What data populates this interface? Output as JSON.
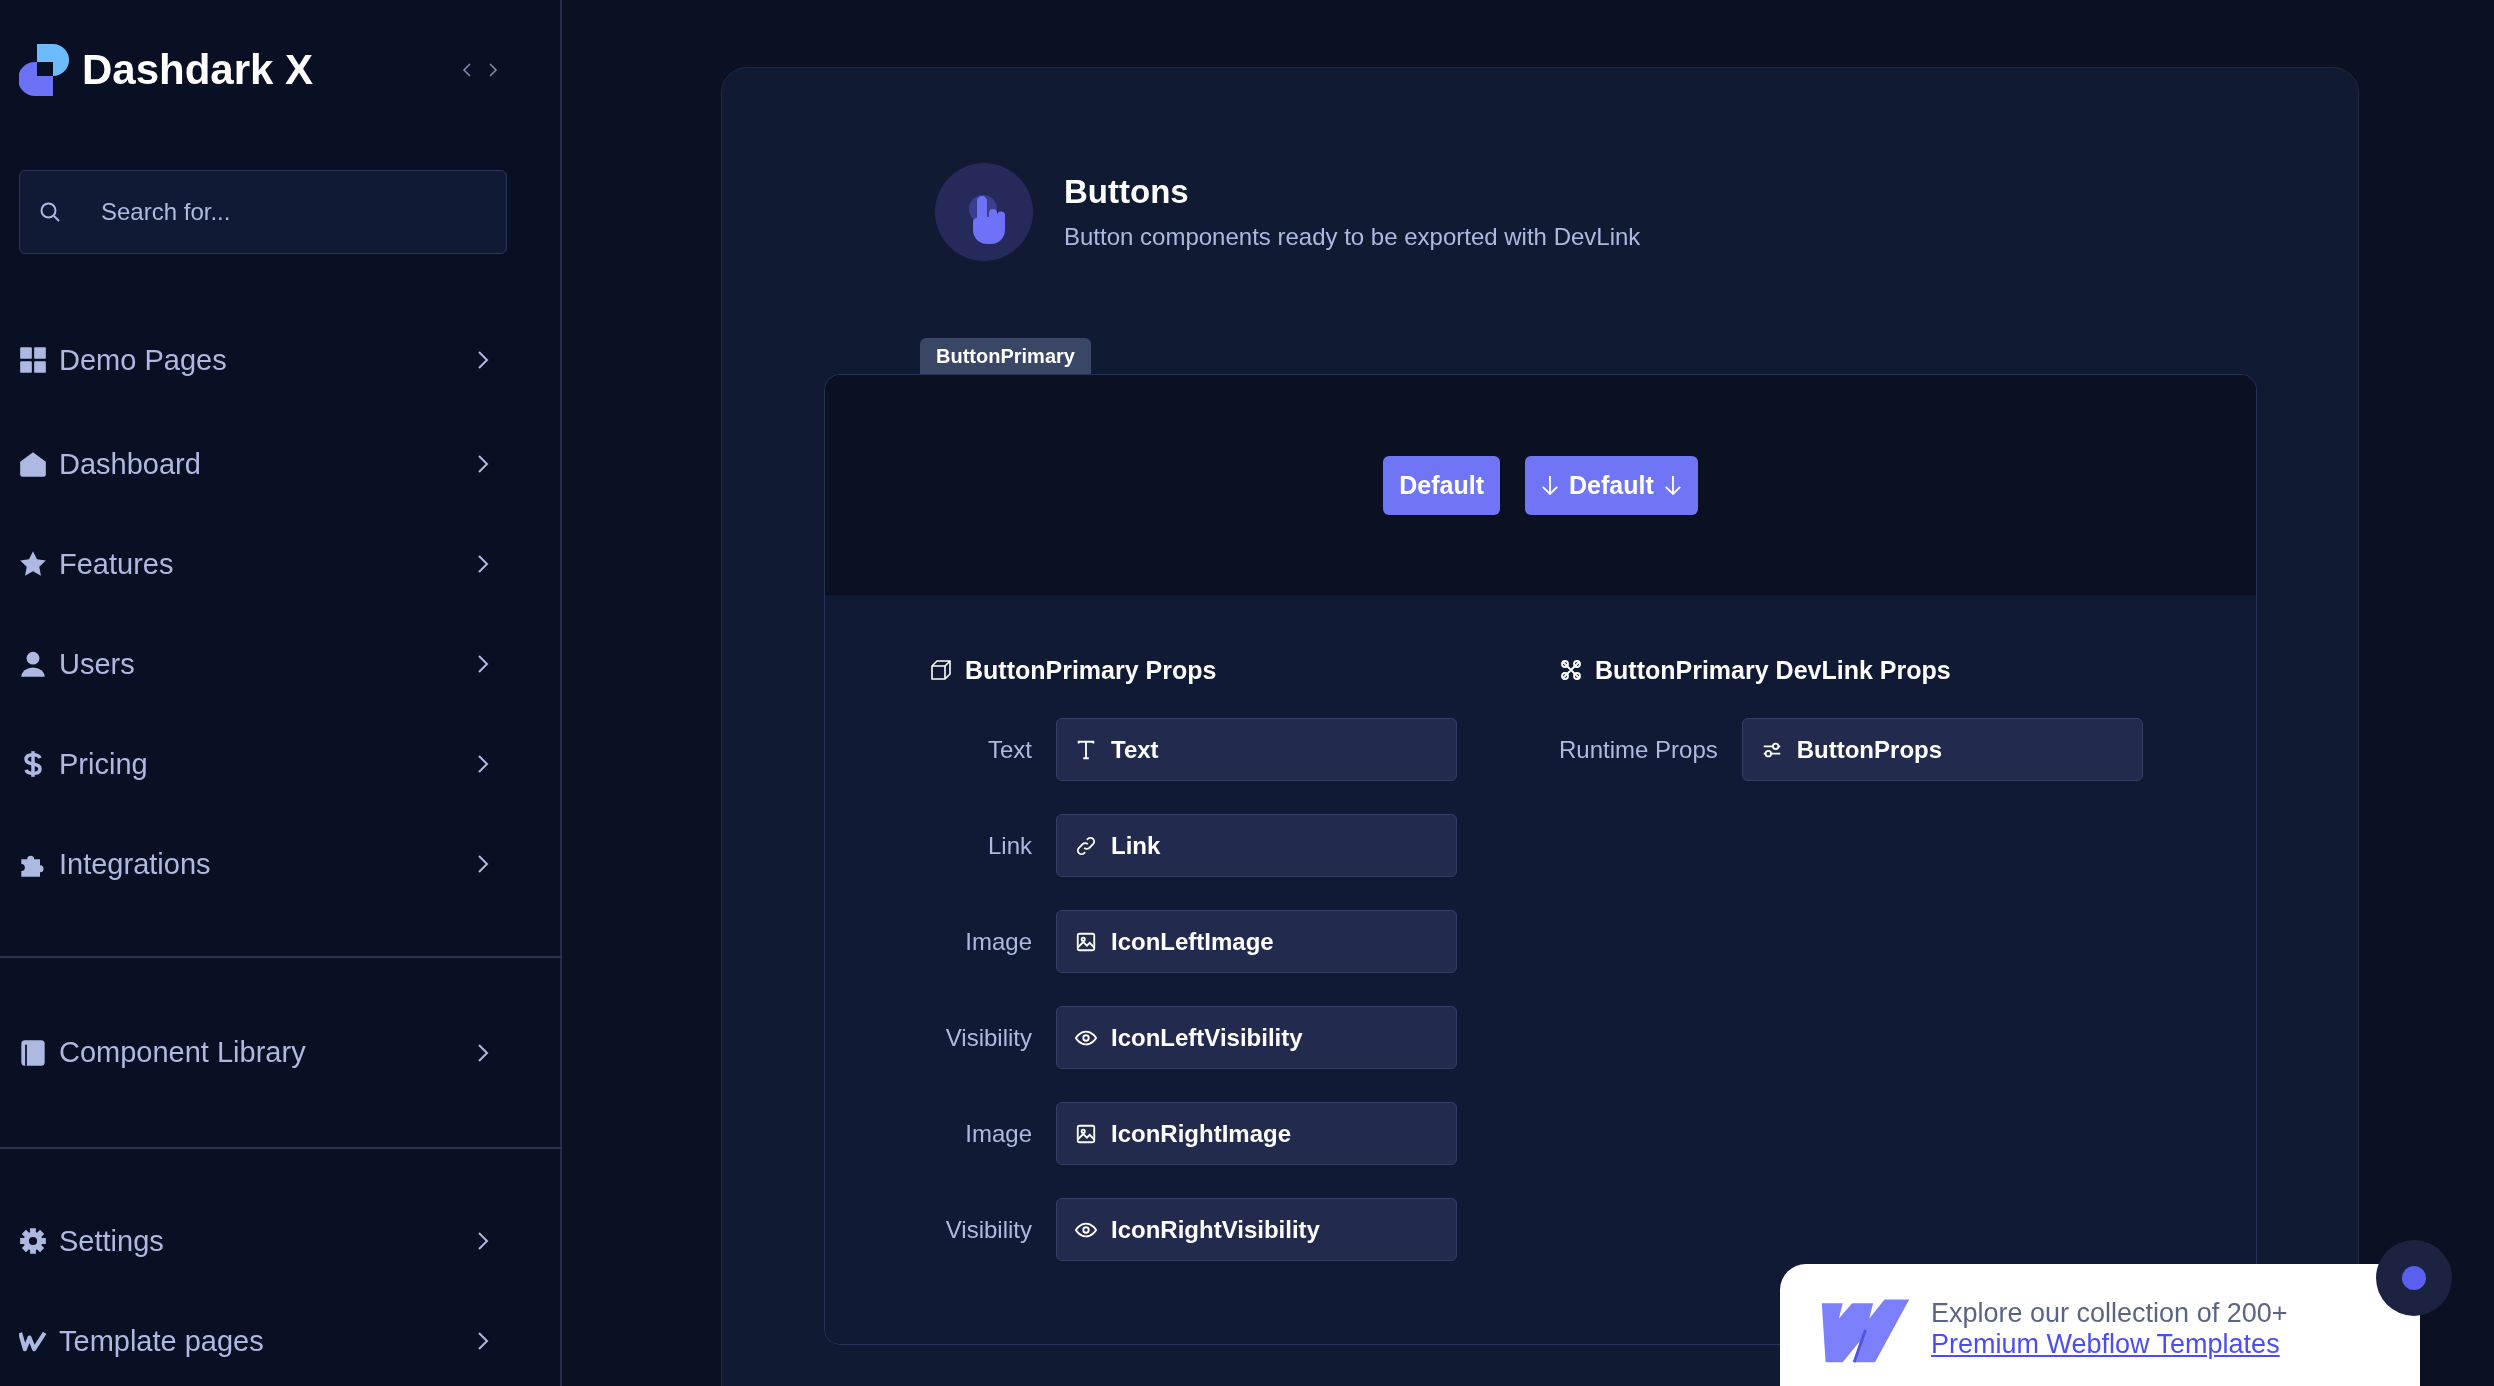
{
  "brand": {
    "name": "Dashdark X"
  },
  "search": {
    "placeholder": "Search for..."
  },
  "nav_groups": [
    {
      "items": [
        {
          "label": "Demo Pages"
        },
        {
          "label": "Dashboard"
        },
        {
          "label": "Features"
        },
        {
          "label": "Users"
        },
        {
          "label": "Pricing"
        },
        {
          "label": "Integrations"
        }
      ]
    },
    {
      "items": [
        {
          "label": "Component Library"
        }
      ]
    },
    {
      "items": [
        {
          "label": "Settings"
        },
        {
          "label": "Template pages"
        }
      ]
    }
  ],
  "header": {
    "title": "Buttons",
    "subtitle": "Button components ready to be exported with DevLink"
  },
  "component": {
    "tab": "ButtonPrimary",
    "preview_buttons": [
      {
        "label": "Default",
        "kind": "plain"
      },
      {
        "label": "Default",
        "kind": "arrows"
      }
    ],
    "props": {
      "title": "ButtonPrimary Props",
      "rows": [
        {
          "label": "Text",
          "value": "Text"
        },
        {
          "label": "Link",
          "value": "Link"
        },
        {
          "label": "Image",
          "value": "IconLeftImage"
        },
        {
          "label": "Visibility",
          "value": "IconLeftVisibility"
        },
        {
          "label": "Image",
          "value": "IconRightImage"
        },
        {
          "label": "Visibility",
          "value": "IconRightVisibility"
        }
      ]
    },
    "devlink_props": {
      "title": "ButtonPrimary DevLink Props",
      "rows": [
        {
          "label": "Runtime Props",
          "value": "ButtonProps"
        }
      ]
    }
  },
  "promo": {
    "text": "Explore our collection of 200+",
    "link": "Premium Webflow Templates"
  }
}
